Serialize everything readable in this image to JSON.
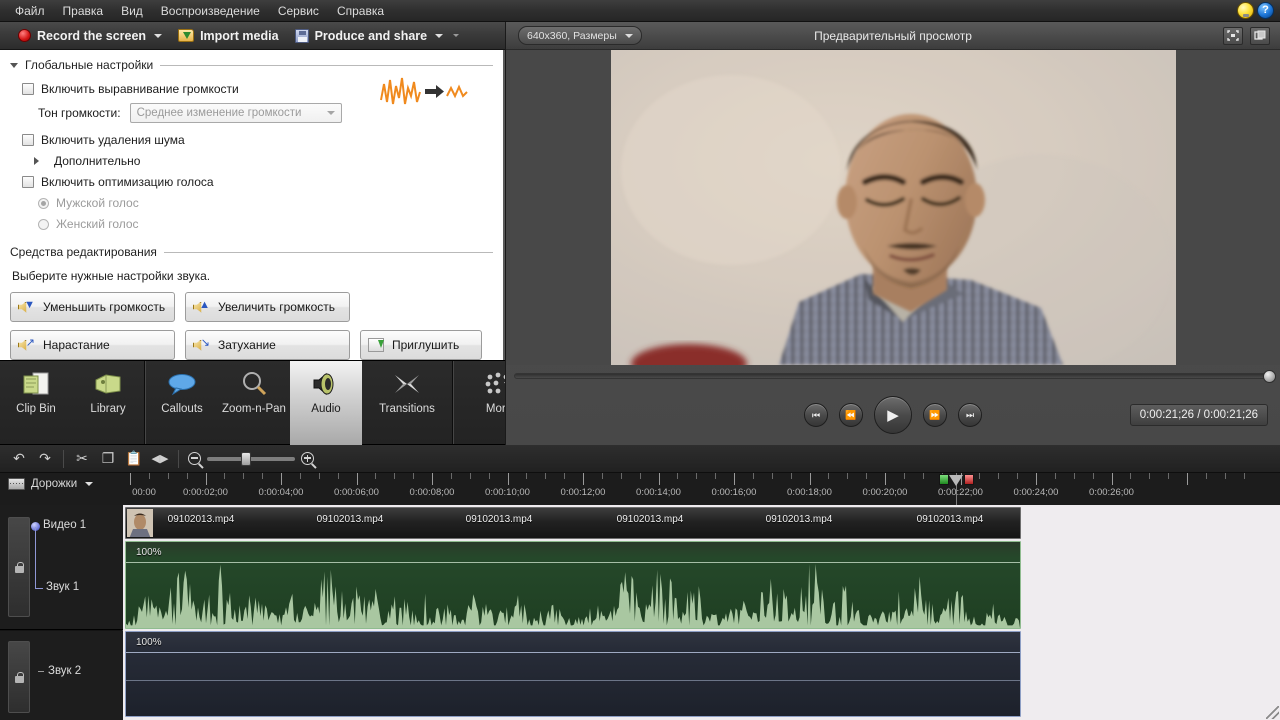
{
  "menu": {
    "items": [
      "Файл",
      "Правка",
      "Вид",
      "Воспроизведение",
      "Сервис",
      "Справка"
    ],
    "tips_icon": "lightbulb-icon",
    "help_icon": "help-icon",
    "help_glyph": "?"
  },
  "toolbar": {
    "record_label": "Record the screen",
    "import_label": "Import media",
    "produce_label": "Produce and share"
  },
  "settings": {
    "global_section_title": "Глобальные настройки",
    "enable_leveling_label": "Включить выравнивание громкости",
    "volume_tone_label": "Тон громкости:",
    "volume_tone_value": "Среднее изменение громкости",
    "enable_noise_removal_label": "Включить удаления шума",
    "advanced_label": "Дополнительно",
    "enable_voice_optimize_label": "Включить оптимизацию голоса",
    "male_voice_label": "Мужской голос",
    "female_voice_label": "Женский голос",
    "editing_tools_title": "Средства редактирования",
    "editing_tools_hint": "Выберите нужные настройки звука.",
    "buttons": [
      "Уменьшить громкость",
      "Увеличить громкость",
      "Нарастание",
      "Затухание",
      "Приглушить"
    ],
    "accent_wave_color": "#f08a1e"
  },
  "tabs": {
    "items": [
      {
        "label": "Clip Bin",
        "icon": "clip-bin-icon",
        "active": false
      },
      {
        "label": "Library",
        "icon": "library-icon",
        "active": false
      },
      {
        "label": "Callouts",
        "icon": "callout-icon",
        "active": false
      },
      {
        "label": "Zoom-n-Pan",
        "icon": "zoom-pan-icon",
        "active": false
      },
      {
        "label": "Audio",
        "icon": "audio-icon",
        "active": true
      },
      {
        "label": "Transitions",
        "icon": "transitions-icon",
        "active": false
      },
      {
        "label": "More",
        "icon": "more-icon",
        "active": false
      }
    ]
  },
  "preview": {
    "dimensions_value": "640x360, Размеры",
    "title": "Предварительный просмотр",
    "fullscreen_icon": "fullscreen-icon",
    "detach_icon": "detach-window-icon",
    "controls": {
      "prev": "skip-back-icon",
      "rewind": "rewind-icon",
      "play": "play-icon",
      "forward": "fast-forward-icon",
      "next": "skip-forward-icon"
    },
    "timecode": "0:00:21;26 / 0:00:21;26"
  },
  "timeline": {
    "tools": [
      {
        "name": "undo-icon",
        "glyph": "↶"
      },
      {
        "name": "redo-icon",
        "glyph": "↷"
      },
      {
        "name": "cut-icon",
        "glyph": "✂"
      },
      {
        "name": "copy-icon",
        "glyph": "❐"
      },
      {
        "name": "paste-icon",
        "glyph": "📋"
      },
      {
        "name": "split-icon",
        "glyph": "◀▶"
      }
    ],
    "tracks_label": "Дорожки",
    "zoom_level_pct": 35,
    "ruler": {
      "start": "00:00",
      "interval_seconds": 2,
      "labels": [
        "00:00",
        "0:00:02;00",
        "0:00:04;00",
        "0:00:06;00",
        "0:00:08;00",
        "0:00:10;00",
        "0:00:12;00",
        "0:00:14;00",
        "0:00:16;00",
        "0:00:18;00",
        "0:00:20;00",
        "0:00:22;00",
        "0:00:24;00",
        "0:00:26;00"
      ]
    },
    "playhead_time": "0:00:21;26",
    "tracks": [
      {
        "name": "Видео 1",
        "type": "video"
      },
      {
        "name": "Звук 1",
        "type": "audio"
      },
      {
        "name": "Звук 2",
        "type": "audio"
      }
    ],
    "clip_filename": "09102013.mp4",
    "clip_label_count": 6,
    "audio1_volume": "100%",
    "audio2_volume": "100%"
  }
}
